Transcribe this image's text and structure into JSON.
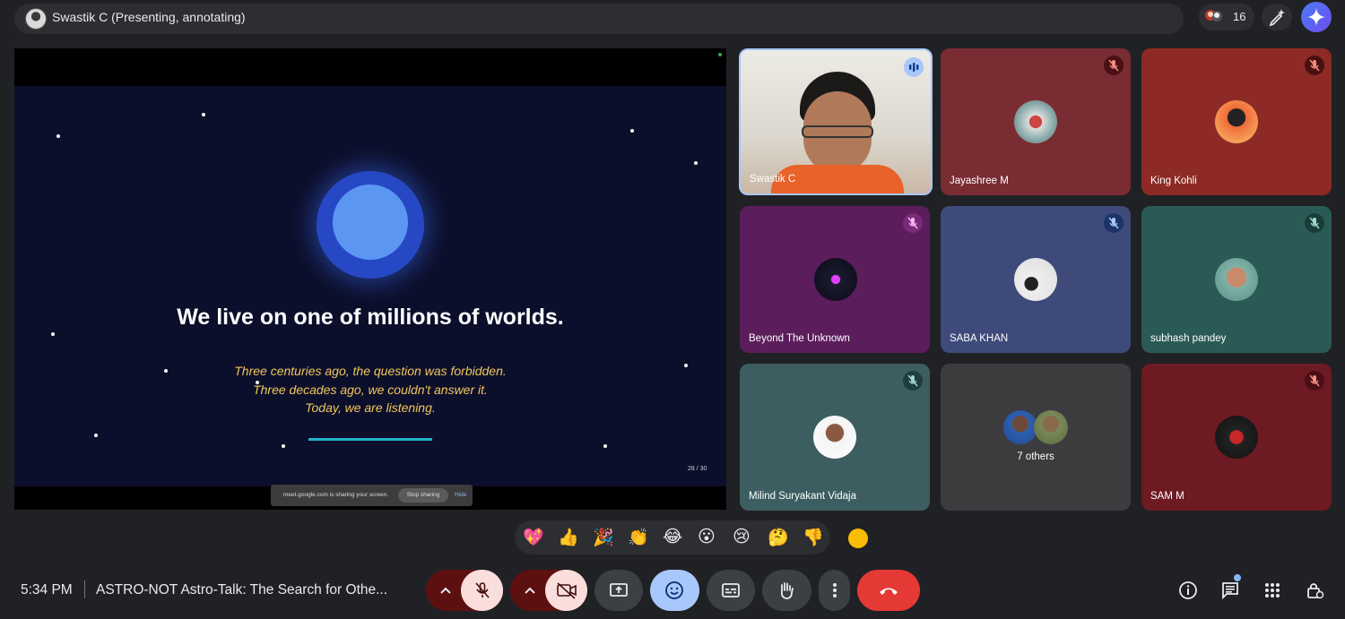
{
  "topbar": {
    "presenter_label": "Swastik C (Presenting, annotating)",
    "participant_count": "16"
  },
  "slide": {
    "headline": "We live on one of millions of worlds.",
    "lines": [
      "Three centuries ago, the question was forbidden.",
      "Three decades ago, we couldn't answer it.",
      "Today, we are listening."
    ],
    "page": "28 / 30"
  },
  "share_bar": {
    "text": "meet.google.com is sharing your screen.",
    "stop_label": "Stop sharing",
    "hide_label": "Hide"
  },
  "tiles": [
    {
      "name": "Swastik C",
      "status": "speaking"
    },
    {
      "name": "Jayashree M",
      "status": "muted",
      "color": "#7a2c33"
    },
    {
      "name": "King Kohli",
      "status": "muted",
      "color": "#8d2a25"
    },
    {
      "name": "Beyond The Unknown",
      "status": "muted",
      "color": "#5c1d5c"
    },
    {
      "name": "SABA KHAN",
      "status": "muted",
      "color": "#3d4a7a"
    },
    {
      "name": "subhash pandey",
      "status": "muted",
      "color": "#2a5a55"
    },
    {
      "name": "Milind Suryakant Vidaja",
      "status": "muted",
      "color": "#3c5e60"
    },
    {
      "name": "7 others",
      "color": "#3c3c3f"
    },
    {
      "name": "SAM M",
      "status": "muted",
      "color": "#6e1a22"
    }
  ],
  "reactions": [
    "💖",
    "👍",
    "🎉",
    "👏",
    "😂",
    "😮",
    "😢",
    "🤔",
    "👎"
  ],
  "bottom": {
    "time": "5:34 PM",
    "meeting_title": "ASTRO-NOT Astro-Talk: The Search for Othe..."
  },
  "icons": [
    "mic-off-icon",
    "camera-off-icon",
    "present-icon",
    "emoji-icon",
    "captions-icon",
    "raise-hand-icon",
    "more-icon",
    "end-call-icon",
    "info-icon",
    "chat-icon",
    "apps-icon",
    "host-controls-icon"
  ],
  "colors": {
    "accent": "#a8c7fa",
    "end_call": "#e53935",
    "muted_control": "#f9dedc"
  }
}
